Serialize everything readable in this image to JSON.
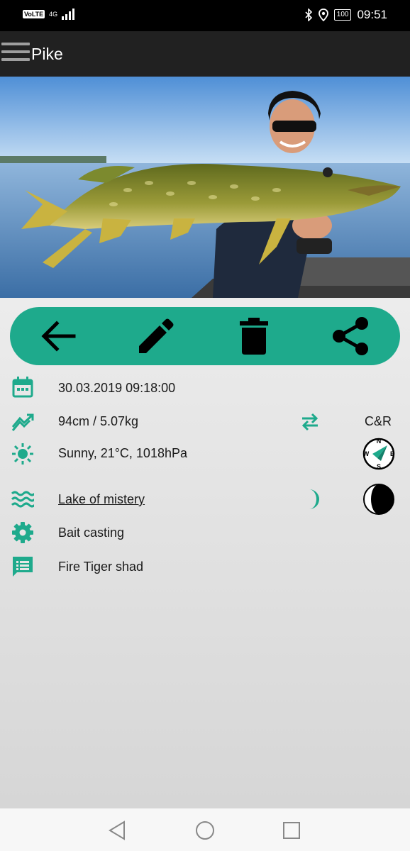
{
  "status_bar": {
    "network_badge": "VoLTE",
    "network_type": "4G",
    "battery": "100",
    "time": "09:51",
    "icons": [
      "signal-icon",
      "bluetooth-icon",
      "location-icon",
      "battery-icon"
    ]
  },
  "app_bar": {
    "title": "Pike",
    "icon": "hamburger-menu-icon"
  },
  "photo": {
    "subject": "pike-catch-photo"
  },
  "action_bar": {
    "color": "#1eaa8c",
    "actions": [
      "back-arrow-icon",
      "edit-pencil-icon",
      "delete-trash-icon",
      "share-icon"
    ]
  },
  "details": {
    "date_time": "30.03.2019 09:18:00",
    "size": "94cm / 5.07kg",
    "release": "C&R",
    "weather": "Sunny, 21°C, 1018hPa",
    "wind_compass": {
      "N": "N",
      "E": "E",
      "S": "S",
      "W": "W"
    },
    "location": "Lake of mistery",
    "method": "Bait casting",
    "bait": "Fire Tiger shad",
    "accent_color": "#1eaa8c",
    "icons": [
      "calendar-icon",
      "trend-icon",
      "swap-icon",
      "sun-icon",
      "compass-icon",
      "waves-icon",
      "crescent-moon-icon",
      "moon-phase-icon",
      "gear-icon",
      "notes-icon"
    ]
  },
  "nav_bar": {
    "icons": [
      "back-triangle-icon",
      "home-circle-icon",
      "recents-square-icon"
    ]
  }
}
